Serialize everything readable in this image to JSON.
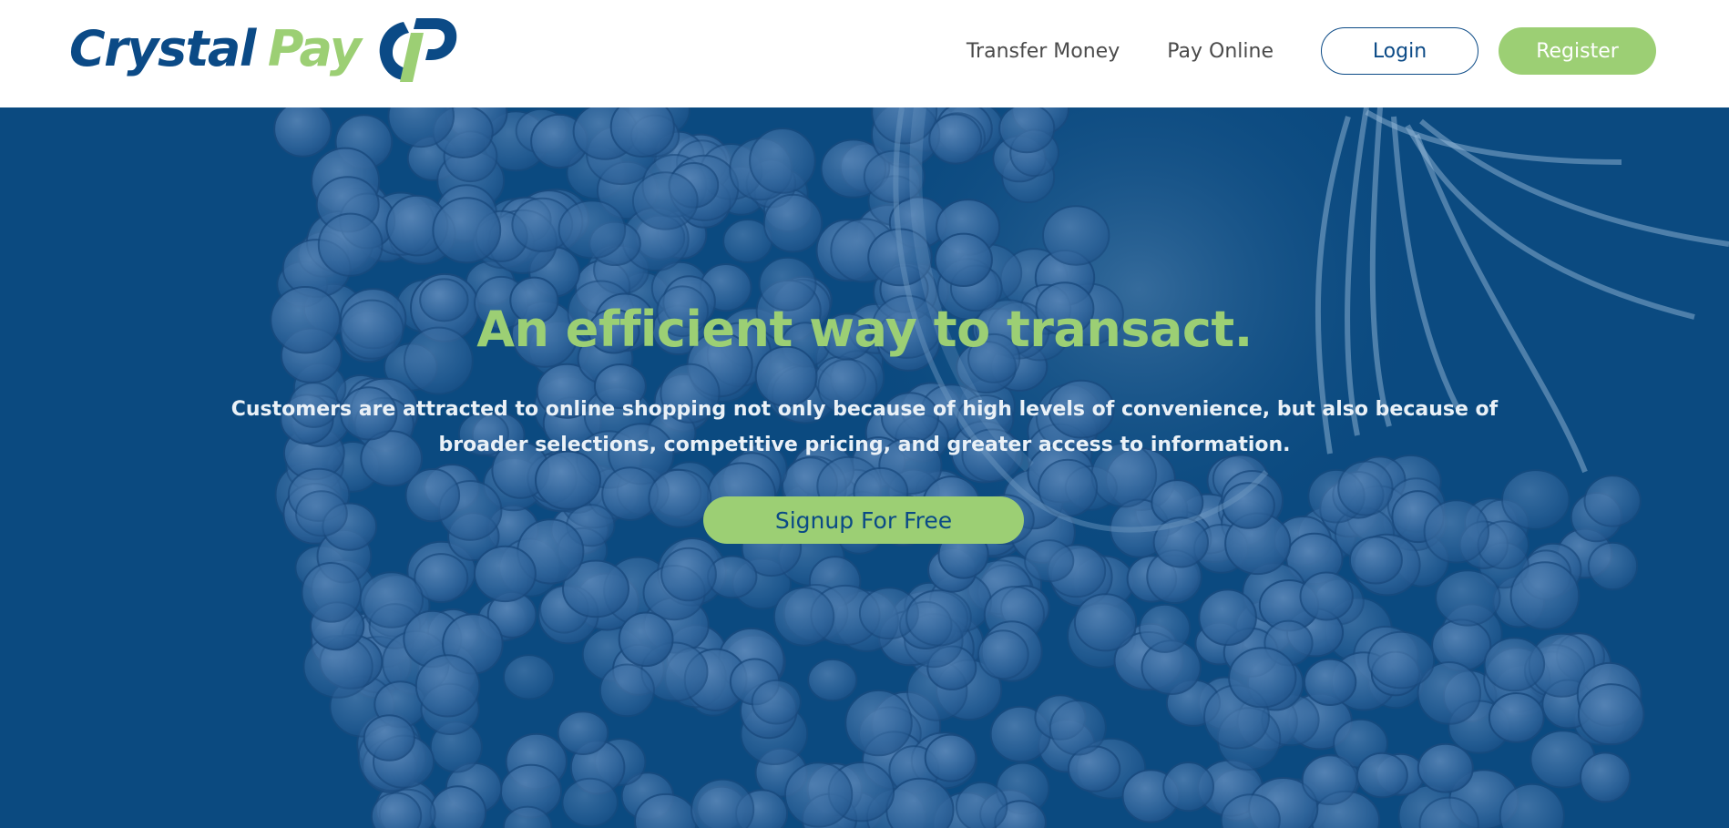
{
  "brand": {
    "name_part1": "Crystal",
    "name_part2": "Pay",
    "colors": {
      "primary": "#0b4a86",
      "accent": "#9ccf74"
    }
  },
  "header": {
    "nav_links": [
      "Transfer Money",
      "Pay Online"
    ],
    "login_label": "Login",
    "register_label": "Register"
  },
  "hero": {
    "title": "An efficient way to transact.",
    "description": "Customers are attracted to online shopping not only because of high levels of convenience, but also because of broader selections, competitive pricing, and greater access to information.",
    "cta_label": "Signup For Free",
    "background_description_icon": "coins-background"
  }
}
